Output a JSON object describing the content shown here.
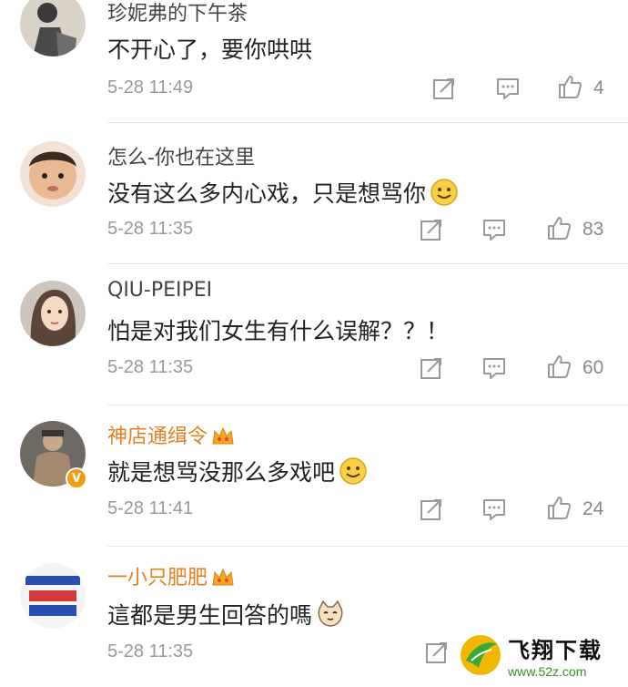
{
  "comments": [
    {
      "username": "珍妮弗的下午茶",
      "text": "不开心了，要你哄哄",
      "time": "5-28 11:49",
      "likes": "4",
      "avatar_icon": "avatar-photo-icon",
      "has_emoji": false
    },
    {
      "username": "怎么-你也在这里",
      "text": "没有这么多内心戏，只是想骂你",
      "time": "5-28 11:35",
      "likes": "83",
      "avatar_icon": "avatar-photo-icon",
      "has_emoji": true,
      "emoji": "smile-emoji-icon"
    },
    {
      "username": "QIU-PEIPEI",
      "text": "怕是对我们女生有什么误解？？！",
      "time": "5-28 11:35",
      "likes": "60",
      "avatar_icon": "avatar-photo-icon",
      "has_emoji": false
    },
    {
      "username": "神店通缉令",
      "text": "就是想骂没那么多戏吧",
      "time": "5-28 11:41",
      "likes": "24",
      "avatar_icon": "avatar-photo-icon",
      "has_emoji": true,
      "emoji": "smile-emoji-icon",
      "verified": true,
      "member_crown": true
    },
    {
      "username": "一小只肥肥",
      "text": "這都是男生回答的嗎",
      "time": "5-28 11:35",
      "likes": "",
      "avatar_icon": "avatar-photo-icon",
      "has_emoji": true,
      "emoji": "cat-emoji-icon",
      "member_crown": true
    }
  ],
  "watermark": {
    "title": "飞翔下载",
    "url": "www.52z.com"
  },
  "colors": {
    "username_member": "#e67e22",
    "meta_gray": "#999999",
    "divider": "#e8e8e8"
  }
}
